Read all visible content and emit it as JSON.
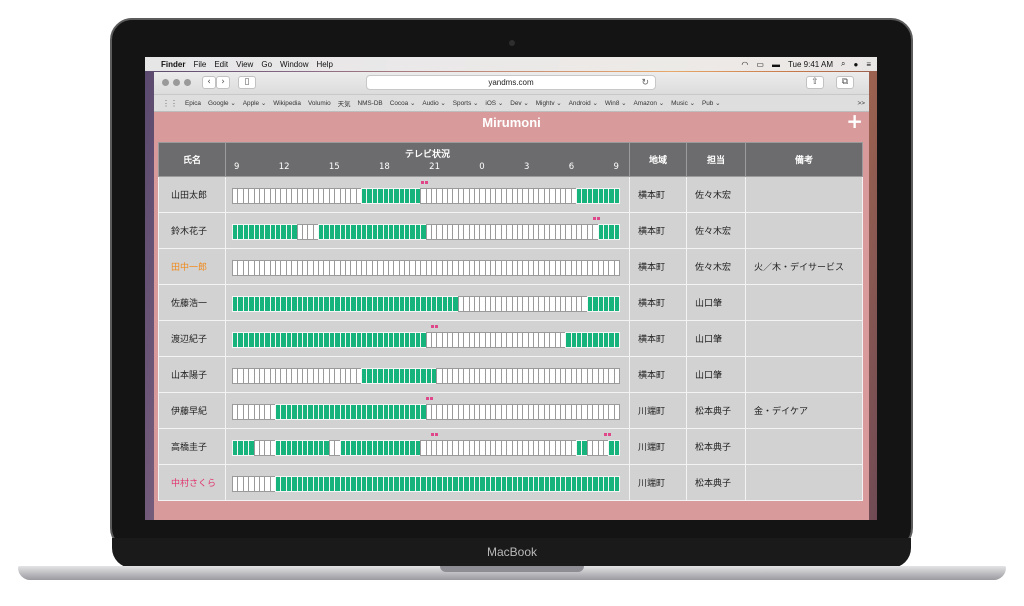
{
  "menubar": {
    "items": [
      "Finder",
      "File",
      "Edit",
      "View",
      "Go",
      "Window",
      "Help"
    ],
    "clock": "Tue 9:41 AM"
  },
  "browser": {
    "url": "yandms.com",
    "bookmarks": [
      "Epica",
      "Google ⌄",
      "Apple ⌄",
      "Wikipedia",
      "Volumio",
      "天気",
      "NMS-DB",
      "Cocoa ⌄",
      "Audio ⌄",
      "Sports ⌄",
      "iOS ⌄",
      "Dev ⌄",
      "Mightv ⌄",
      "Android ⌄",
      "Win8 ⌄",
      "Amazon ⌄",
      "Music ⌄",
      "Pub ⌄"
    ],
    "more": ">>"
  },
  "app": {
    "title": "Mirumoni",
    "add_label": "+",
    "headers": {
      "name": "氏名",
      "tv": "テレビ状況",
      "area": "地域",
      "staff": "担当",
      "note": "備考"
    },
    "hour_ticks": [
      "9",
      "12",
      "15",
      "18",
      "21",
      "0",
      "3",
      "6",
      "9"
    ],
    "colors": {
      "on": "#16b37c",
      "off": "#ffffff",
      "mark": "#e0478a",
      "header": "#6c6c6e",
      "page": "#d89a9a"
    },
    "rows": [
      {
        "name": "山田太郎",
        "name_color": "#222222",
        "area": "横本町",
        "staff": "佐々木宏",
        "note": "",
        "on": [
          [
            24,
            35
          ],
          [
            64,
            72
          ]
        ],
        "marks": [
          35
        ]
      },
      {
        "name": "鈴木花子",
        "name_color": "#222222",
        "area": "横本町",
        "staff": "佐々木宏",
        "note": "",
        "on": [
          [
            0,
            12
          ],
          [
            16,
            36
          ],
          [
            68,
            72
          ]
        ],
        "marks": [
          67
        ]
      },
      {
        "name": "田中一郎",
        "name_color": "#f08a1d",
        "area": "横本町",
        "staff": "佐々木宏",
        "note": "火／木・デイサービス",
        "on": [],
        "marks": []
      },
      {
        "name": "佐藤浩一",
        "name_color": "#222222",
        "area": "横本町",
        "staff": "山口肇",
        "note": "",
        "on": [
          [
            0,
            42
          ],
          [
            66,
            72
          ]
        ],
        "marks": []
      },
      {
        "name": "渡辺紀子",
        "name_color": "#222222",
        "area": "横本町",
        "staff": "山口肇",
        "note": "",
        "on": [
          [
            0,
            36
          ],
          [
            62,
            72
          ]
        ],
        "marks": [
          37
        ]
      },
      {
        "name": "山本陽子",
        "name_color": "#222222",
        "area": "横本町",
        "staff": "山口肇",
        "note": "",
        "on": [
          [
            24,
            38
          ]
        ],
        "marks": []
      },
      {
        "name": "伊藤早紀",
        "name_color": "#222222",
        "area": "川端町",
        "staff": "松本典子",
        "note": "金・デイケア",
        "on": [
          [
            8,
            36
          ]
        ],
        "marks": [
          36
        ]
      },
      {
        "name": "高橋圭子",
        "name_color": "#222222",
        "area": "川端町",
        "staff": "松本典子",
        "note": "",
        "on": [
          [
            0,
            4
          ],
          [
            8,
            18
          ],
          [
            20,
            35
          ],
          [
            64,
            66
          ],
          [
            70,
            72
          ]
        ],
        "marks": [
          37,
          69
        ]
      },
      {
        "name": "中村さくら",
        "name_color": "#e0336e",
        "area": "川端町",
        "staff": "松本典子",
        "note": "",
        "on": [
          [
            8,
            72
          ]
        ],
        "marks": []
      }
    ]
  }
}
